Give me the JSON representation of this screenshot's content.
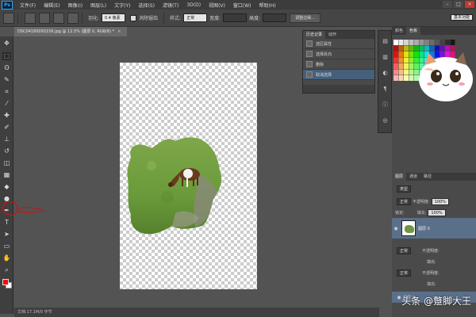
{
  "menubar": {
    "logo": "Ps",
    "items": [
      "文件(F)",
      "编辑(E)",
      "图像(I)",
      "图层(L)",
      "文字(Y)",
      "选择(S)",
      "滤镜(T)",
      "3D(D)",
      "视图(V)",
      "窗口(W)",
      "帮助(H)"
    ],
    "window_controls": [
      "–",
      "□",
      "×"
    ]
  },
  "options": {
    "feather_label": "羽化:",
    "feather_value": "0.4 像素",
    "antialias_label": "消除锯齿",
    "style_label": "样式:",
    "style_value": "正常",
    "width_label": "宽度:",
    "height_label": "高度:",
    "refine_button": "调整边缘...",
    "workspace": "基本功能"
  },
  "document": {
    "tab_title": "DSC04180093156.jpg @ 12.5% (图层 0, RGB/8) *",
    "close_glyph": "×",
    "status_text": "文档:17.1M/0 字节"
  },
  "toolbar": {
    "tools": [
      "move-tool",
      "marquee-tool",
      "lasso-tool",
      "quick-select-tool",
      "crop-tool",
      "eyedropper-tool",
      "healing-tool",
      "brush-tool",
      "clone-tool",
      "history-brush-tool",
      "eraser-tool",
      "gradient-tool",
      "blur-tool",
      "dodge-tool",
      "pen-tool",
      "type-tool",
      "path-select-tool",
      "shape-tool",
      "hand-tool",
      "zoom-tool"
    ],
    "foreground_color": "#ff0000",
    "background_color": "#ffffff",
    "annotation_color": "#cc1111"
  },
  "history": {
    "tabs": [
      "历史记录",
      "动作"
    ],
    "rows": [
      {
        "label": "选区属性",
        "selected": false
      },
      {
        "label": "选择反向",
        "selected": false
      },
      {
        "label": "删除",
        "selected": false
      },
      {
        "label": "取消选择",
        "selected": true
      }
    ]
  },
  "swatches": {
    "tabs": [
      "颜色",
      "色板"
    ],
    "style_button": "基本功能"
  },
  "layers": {
    "tabs": [
      "图层",
      "通道",
      "路径"
    ],
    "kind_label": "类型",
    "blend_mode": "正常",
    "opacity_label": "不透明度:",
    "opacity_value": "100%",
    "lock_label": "锁定:",
    "fill_label": "填充:",
    "fill_value": "100%",
    "layer_name": "图层 0"
  },
  "lower_panels": {
    "blend_mode_a": "正常",
    "opacity_label_a": "不透明度:",
    "fill_label_a": "填充:",
    "blend_mode_b": "正常",
    "opacity_label_b": "不透明度:",
    "fill_label_b": "填充:",
    "layer_name_b": "图层 0"
  },
  "watermark": "头条 @蹩脚大王"
}
